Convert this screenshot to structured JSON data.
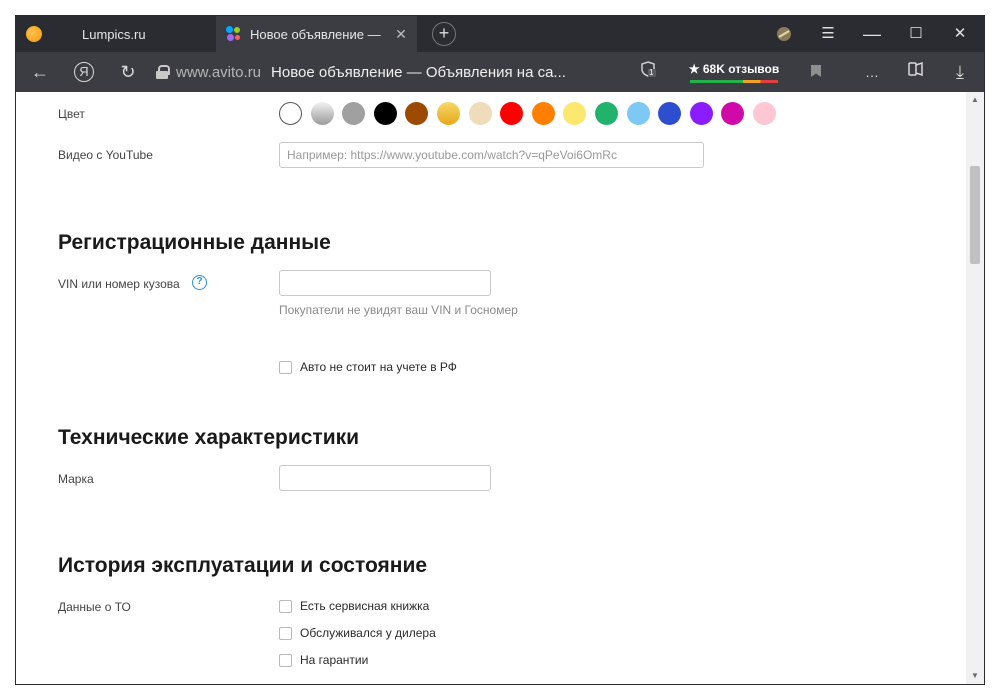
{
  "tabs": [
    {
      "title": "Lumpics.ru",
      "active": false
    },
    {
      "title": "Новое объявление — О",
      "active": true
    }
  ],
  "toolbar": {
    "url_domain": "www.avito.ru",
    "page_title": "Новое объявление — Объявления на са...",
    "reviews_label": "★ 68K отзывов",
    "extension_badge": "1"
  },
  "icons": {
    "back": "arrow-left-icon",
    "yandex": "yandex-icon",
    "reload": "reload-icon",
    "lock": "lock-icon",
    "menu": "hamburger-icon",
    "minimize": "minimize-icon",
    "maximize": "maximize-icon",
    "close": "close-icon",
    "bookmark": "bookmark-icon",
    "more": "more-icon",
    "collections": "collections-icon",
    "download": "download-icon"
  },
  "form": {
    "color_label": "Цвет",
    "colors": [
      "#ffffff",
      "#c8c8c8",
      "#a0a0a0",
      "#000000",
      "#9c4a00",
      "#f2c03a",
      "#efdcba",
      "#ff0000",
      "#ff8000",
      "#fce86f",
      "#21b26b",
      "#7ec8f6",
      "#2d4fcf",
      "#8a1cff",
      "#d00aa8",
      "#ffc6d3"
    ],
    "youtube_label": "Видео с YouTube",
    "youtube_placeholder": "Например: https://www.youtube.com/watch?v=qPeVoi6OmRc",
    "reg_section_title": "Регистрационные данные",
    "vin_label": "VIN или номер кузова",
    "vin_hint": "Покупатели не увидят ваш VIN и Госномер",
    "not_registered_label": "Авто не стоит на учете в РФ",
    "tech_section_title": "Технические характеристики",
    "brand_label": "Марка",
    "history_section_title": "История эксплуатации и состояние",
    "service_label": "Данные о ТО",
    "service_options": [
      "Есть сервисная книжка",
      "Обслуживался у дилера",
      "На гарантии"
    ]
  }
}
